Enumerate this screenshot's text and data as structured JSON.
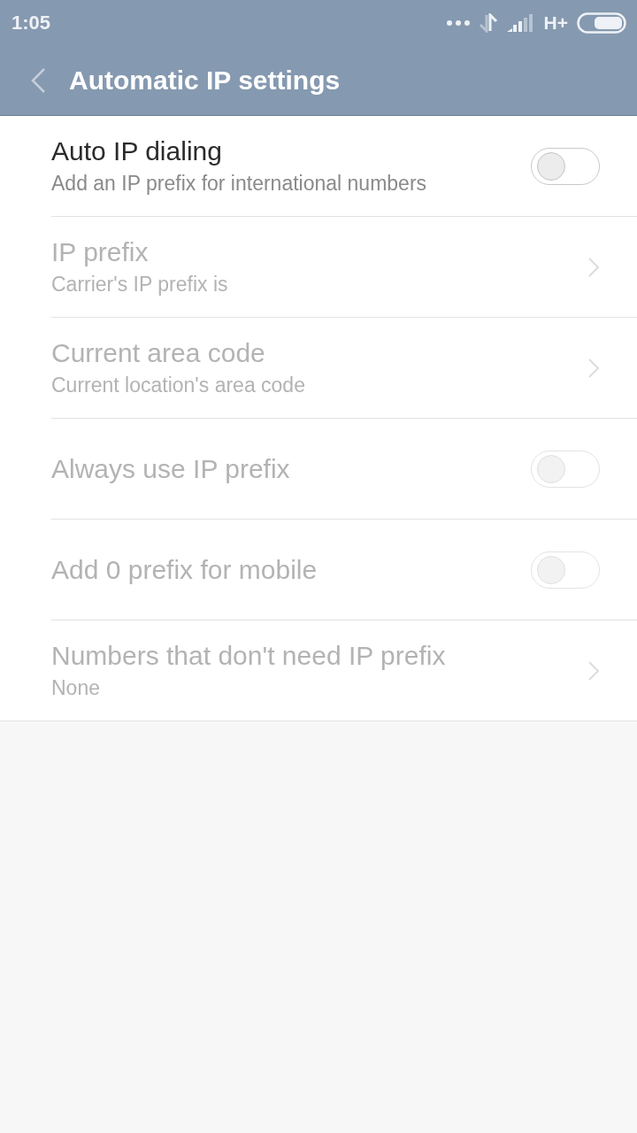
{
  "status_bar": {
    "time": "1:05",
    "network": "H+"
  },
  "header": {
    "title": "Automatic IP settings"
  },
  "settings": [
    {
      "kind": "switch",
      "title": "Auto IP dialing",
      "subtitle": "Add an IP prefix for international numbers",
      "disabled": false,
      "on": false
    },
    {
      "kind": "link",
      "title": "IP prefix",
      "subtitle": "Carrier's IP prefix is",
      "disabled": true
    },
    {
      "kind": "link",
      "title": "Current area code",
      "subtitle": "Current location's area code",
      "disabled": true
    },
    {
      "kind": "switch",
      "title": "Always use IP prefix",
      "disabled": true,
      "on": false
    },
    {
      "kind": "switch",
      "title": "Add 0 prefix for mobile",
      "disabled": true,
      "on": false
    },
    {
      "kind": "link",
      "title": "Numbers that don't need IP prefix",
      "subtitle": "None",
      "disabled": true
    }
  ]
}
